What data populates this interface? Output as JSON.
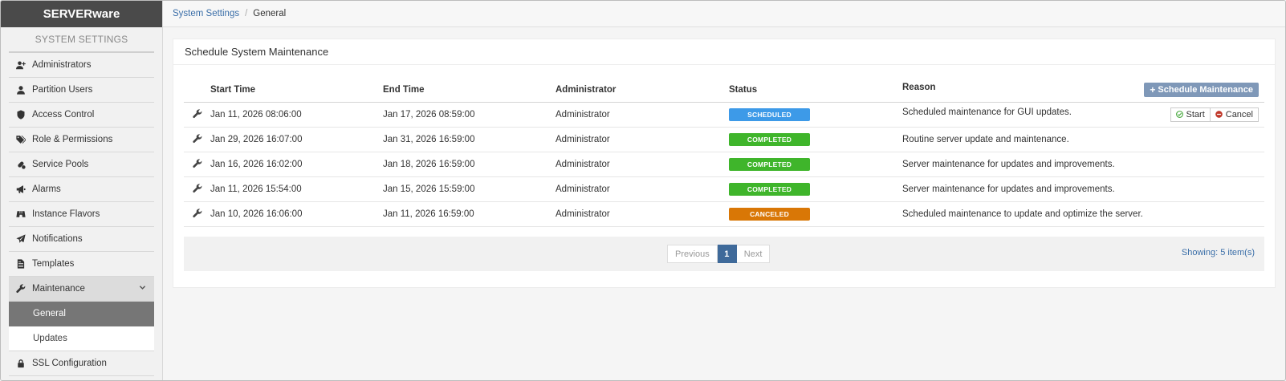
{
  "app": {
    "brand": "SERVERware"
  },
  "sidebar": {
    "heading": "SYSTEM SETTINGS",
    "items": [
      {
        "label": "Administrators",
        "icon": "user-plus-icon"
      },
      {
        "label": "Partition Users",
        "icon": "user-icon"
      },
      {
        "label": "Access Control",
        "icon": "shield-icon"
      },
      {
        "label": "Role & Permissions",
        "icon": "tags-icon"
      },
      {
        "label": "Service Pools",
        "icon": "pills-icon"
      },
      {
        "label": "Alarms",
        "icon": "bullhorn-icon"
      },
      {
        "label": "Instance Flavors",
        "icon": "binoculars-icon"
      },
      {
        "label": "Notifications",
        "icon": "paper-plane-icon"
      },
      {
        "label": "Templates",
        "icon": "file-icon"
      },
      {
        "label": "Maintenance",
        "icon": "wrench-icon"
      },
      {
        "label": "SSL Configuration",
        "icon": "lock-icon"
      }
    ],
    "maintenance_sub": [
      {
        "label": "General"
      },
      {
        "label": "Updates"
      }
    ]
  },
  "breadcrumb": {
    "parent": "System Settings",
    "current": "General"
  },
  "panel": {
    "title": "Schedule System Maintenance",
    "schedule_button": "Schedule Maintenance",
    "columns": [
      "Start Time",
      "End Time",
      "Administrator",
      "Status",
      "Reason"
    ],
    "rows": [
      {
        "start": "Jan 11, 2026 08:06:00",
        "end": "Jan 17, 2026 08:59:00",
        "admin": "Administrator",
        "status": "SCHEDULED",
        "reason": "Scheduled maintenance for GUI updates."
      },
      {
        "start": "Jan 29, 2026 16:07:00",
        "end": "Jan 31, 2026 16:59:00",
        "admin": "Administrator",
        "status": "COMPLETED",
        "reason": "Routine server update and maintenance."
      },
      {
        "start": "Jan 16, 2026 16:02:00",
        "end": "Jan 18, 2026 16:59:00",
        "admin": "Administrator",
        "status": "COMPLETED",
        "reason": "Server maintenance for updates and improvements."
      },
      {
        "start": "Jan 11, 2026 15:54:00",
        "end": "Jan 15, 2026 15:59:00",
        "admin": "Administrator",
        "status": "COMPLETED",
        "reason": "Server maintenance for updates and improvements."
      },
      {
        "start": "Jan 10, 2026 16:06:00",
        "end": "Jan 11, 2026 16:59:00",
        "admin": "Administrator",
        "status": "CANCELED",
        "reason": "Scheduled maintenance to update and optimize the server."
      }
    ],
    "row_actions": {
      "start": "Start",
      "cancel": "Cancel"
    },
    "status_colors": {
      "SCHEDULED": "#3d9ae8",
      "COMPLETED": "#3fb52b",
      "CANCELED": "#d97706"
    }
  },
  "pagination": {
    "previous": "Previous",
    "page": "1",
    "next": "Next",
    "showing": "Showing: 5 item(s)"
  }
}
